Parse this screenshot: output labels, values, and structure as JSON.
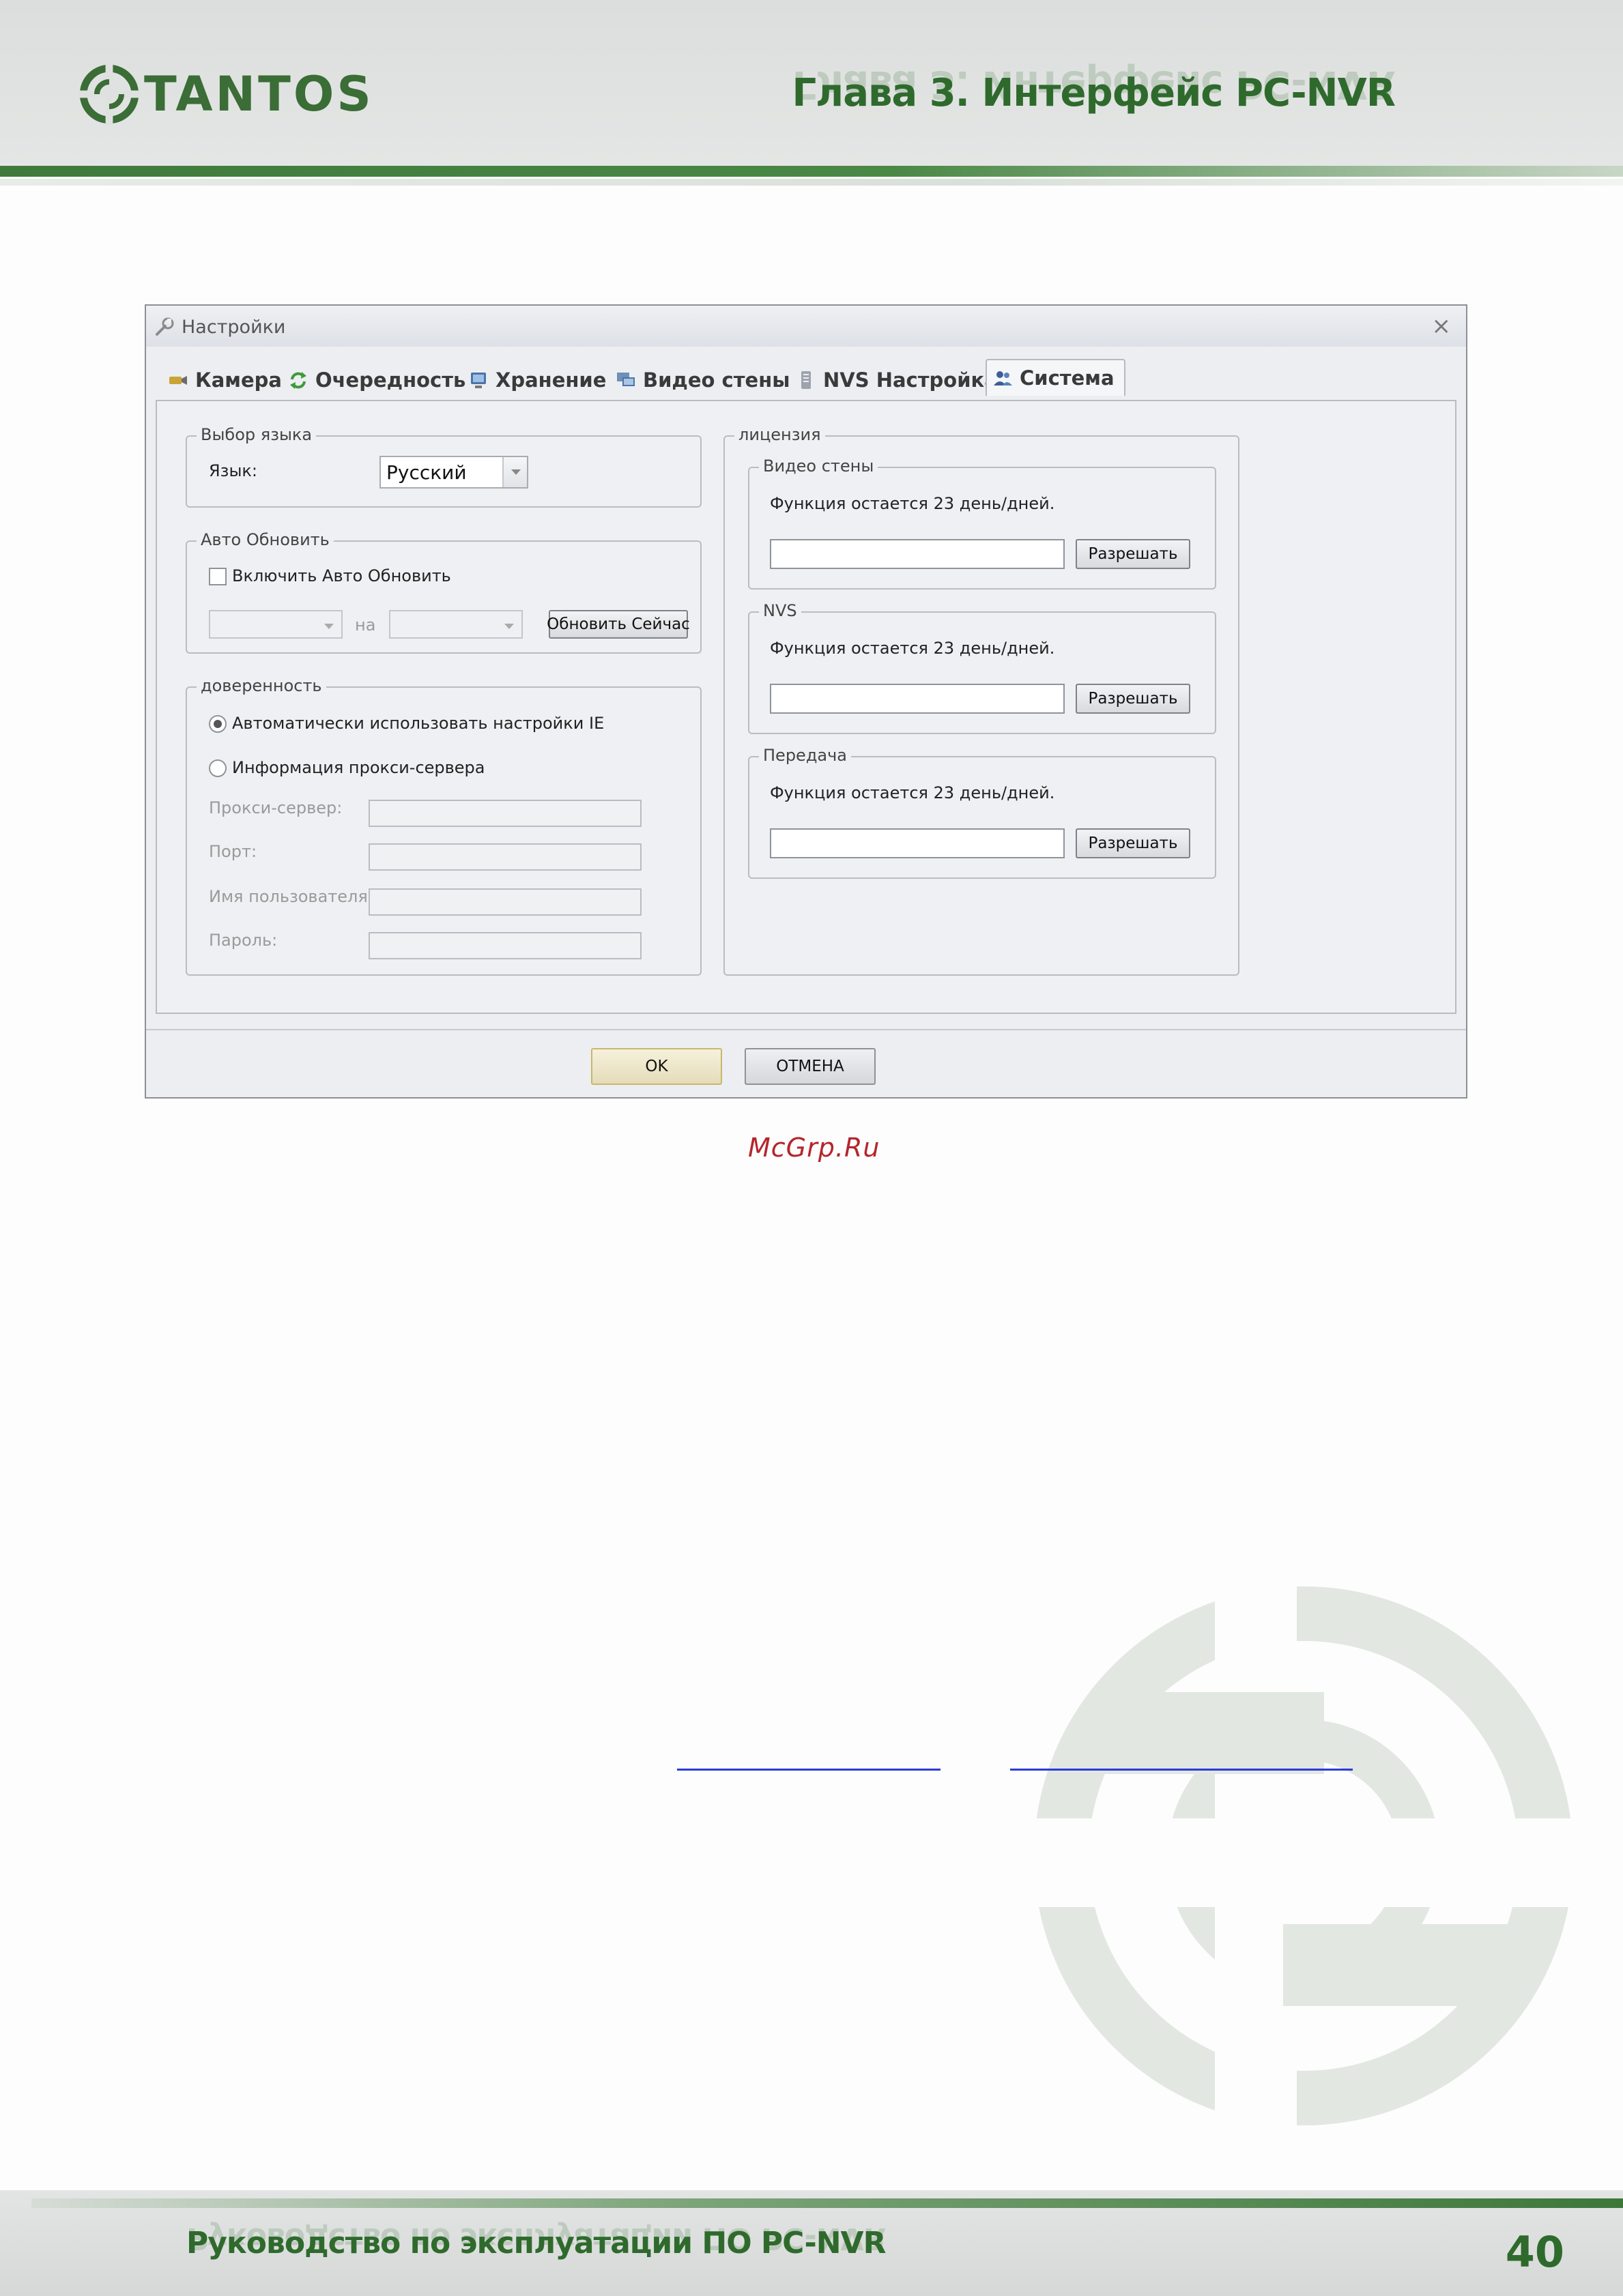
{
  "header": {
    "logo_text": "TANTOS",
    "chapter_title": "Глава 3. Интерфейс PC-NVR"
  },
  "dialog": {
    "title": "Настройки",
    "close_symbol": "×",
    "tabs": [
      {
        "label": "Камера",
        "icon": "camera-icon"
      },
      {
        "label": "Очередность",
        "icon": "refresh-arrows-icon"
      },
      {
        "label": "Хранение",
        "icon": "storage-monitor-icon"
      },
      {
        "label": "Видео стены",
        "icon": "video-wall-icon"
      },
      {
        "label": "NVS Настройка",
        "icon": "server-icon"
      },
      {
        "label": "Система",
        "icon": "users-icon"
      }
    ],
    "active_tab": "Система",
    "language_group": {
      "legend": "Выбор языка",
      "label": "Язык:",
      "value": "Русский"
    },
    "auto_update_group": {
      "legend": "Авто Обновить",
      "checkbox_label": "Включить Авто Обновить",
      "checked": false,
      "between_label": "на",
      "from_value": "",
      "to_value": "",
      "update_now_label": "Обновить Сейчас"
    },
    "proxy_group": {
      "legend": "доверенность",
      "option_auto": "Автоматически использовать настройки IE",
      "option_manual": "Информация прокси-сервера",
      "selected": "auto",
      "fields": [
        {
          "label": "Прокси-сервер:",
          "value": ""
        },
        {
          "label": "Порт:",
          "value": ""
        },
        {
          "label": "Имя пользователя:",
          "value": ""
        },
        {
          "label": "Пароль:",
          "value": ""
        }
      ]
    },
    "license_group": {
      "legend": "лицензия",
      "sections": [
        {
          "legend": "Видео стены",
          "message": "Функция остается 23 день/дней.",
          "key_value": "",
          "button": "Разрешать"
        },
        {
          "legend": "NVS",
          "message": "Функция остается 23 день/дней.",
          "key_value": "",
          "button": "Разрешать"
        },
        {
          "legend": "Передача",
          "message": "Функция остается 23 день/дней.",
          "key_value": "",
          "button": "Разрешать"
        }
      ]
    },
    "ok_label": "OK",
    "cancel_label": "ОТМЕНА"
  },
  "caption_link": "McGrp.Ru",
  "footer": {
    "title": "Руководство по эксплуатации ПО PC-NVR",
    "page_number": "40"
  },
  "colors": {
    "brand_green": "#2f6a2d",
    "link_red": "#b3262c",
    "link_blue": "#2b3bd8"
  }
}
